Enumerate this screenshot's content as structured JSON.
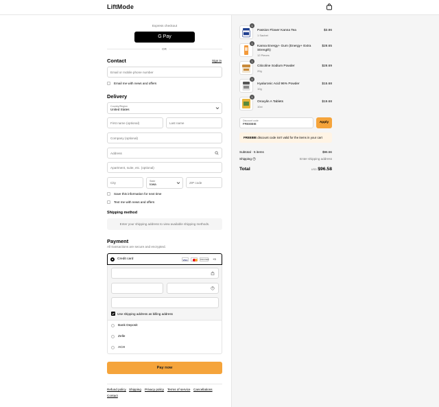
{
  "header": {
    "logo": "LiftMode",
    "cart_icon": "shopping-bag-icon"
  },
  "express": {
    "title": "Express checkout",
    "gpay_label": "G Pay",
    "or": "OR"
  },
  "contact": {
    "heading": "Contact",
    "sign_in": "Sign in",
    "email_placeholder": "Email or mobile phone number",
    "news_label": "Email me with news and offers"
  },
  "delivery": {
    "heading": "Delivery",
    "country_label": "Country/Region",
    "country_value": "United States",
    "first_name": "First name (optional)",
    "last_name": "Last name",
    "company": "Company (optional)",
    "address": "Address",
    "apartment": "Apartment, suite, etc. (optional)",
    "city": "City",
    "state_label": "State",
    "state_value": "Iowa",
    "zip": "ZIP code",
    "save_info": "Save this information for next time",
    "text_me": "Text me with news and offers"
  },
  "shipping": {
    "heading": "Shipping method",
    "notice": "Enter your shipping address to view available shipping methods."
  },
  "payment": {
    "heading": "Payment",
    "subtitle": "All transactions are secure and encrypted.",
    "credit_card": "Credit card",
    "card_brands": [
      "VISA",
      "MC",
      "DISCOVER"
    ],
    "more_brands": "+3",
    "billing_same": "Use shipping address as billing address",
    "options": [
      "Bank Deposit",
      "Zelle",
      "ACH"
    ],
    "pay_button": "Pay now"
  },
  "footer": {
    "links": [
      "Refund policy",
      "Shipping",
      "Privacy policy",
      "Terms of service",
      "Cancellations",
      "Contact"
    ]
  },
  "summary": {
    "items": [
      {
        "name": "Passion Flower Kanna Tea",
        "variant": "1 Sachet",
        "price": "$3.86",
        "qty": "1"
      },
      {
        "name": "Kanna Energy+ Gum (Energy+ Extra Strength)",
        "variant": "12 Pieces",
        "price": "$28.65",
        "qty": "1"
      },
      {
        "name": "Citicoline Sodium Powder",
        "variant": "20g",
        "price": "$28.69",
        "qty": "1"
      },
      {
        "name": "Hyaluronic Acid 96% Powder",
        "variant": "10g",
        "price": "$15.68",
        "qty": "1"
      },
      {
        "name": "Oroxylin A Tablets",
        "variant": "10ct",
        "price": "$19.68",
        "qty": "1"
      }
    ],
    "discount_label": "Discount code",
    "discount_value": "FREEBIE",
    "apply_label": "Apply",
    "error_code": "FREEBIE",
    "error_text": " discount code isn't valid for the items in your cart",
    "subtotal_label": "Subtotal · 5 items",
    "subtotal_value": "$96.56",
    "shipping_label": "Shipping",
    "shipping_value": "Enter shipping address",
    "total_label": "Total",
    "currency": "USD",
    "total_value": "$96.58",
    "colors": {
      "accent": "#f5a43b",
      "error_bg": "#fff4e5"
    }
  }
}
